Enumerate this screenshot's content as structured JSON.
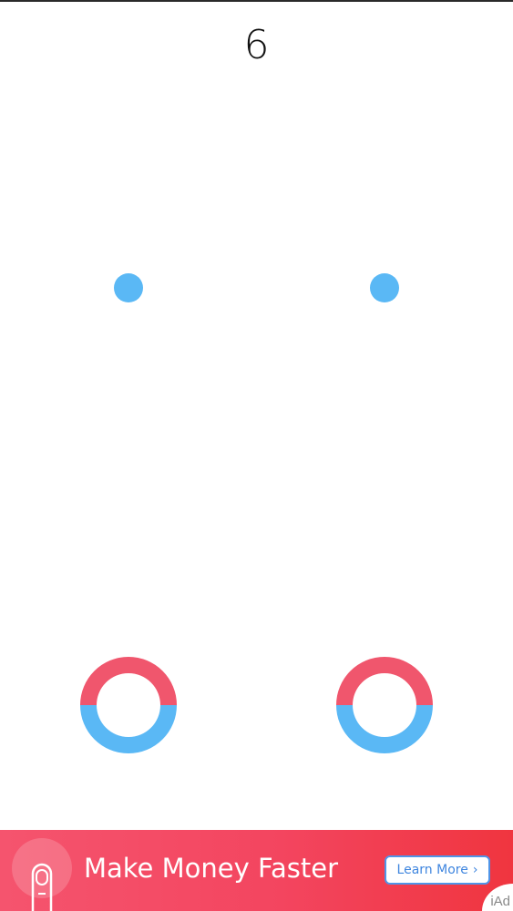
{
  "game": {
    "score": "6",
    "colors": {
      "ball": "#5ab8f5",
      "ring_top": "#f0566d",
      "ring_bottom": "#5ab8f5"
    },
    "balls": [
      {
        "side": "left",
        "color": "blue"
      },
      {
        "side": "right",
        "color": "blue"
      }
    ],
    "rings": [
      {
        "side": "left",
        "top_color": "red",
        "bottom_color": "blue"
      },
      {
        "side": "right",
        "top_color": "red",
        "bottom_color": "blue"
      }
    ]
  },
  "ad": {
    "icon": "tap-finger-icon",
    "headline": "Make Money Faster",
    "button_label": "Learn More",
    "button_chevron": "›",
    "network_label": "iAd",
    "colors": {
      "background": "#f3455f",
      "button_text": "#3f86df"
    }
  }
}
